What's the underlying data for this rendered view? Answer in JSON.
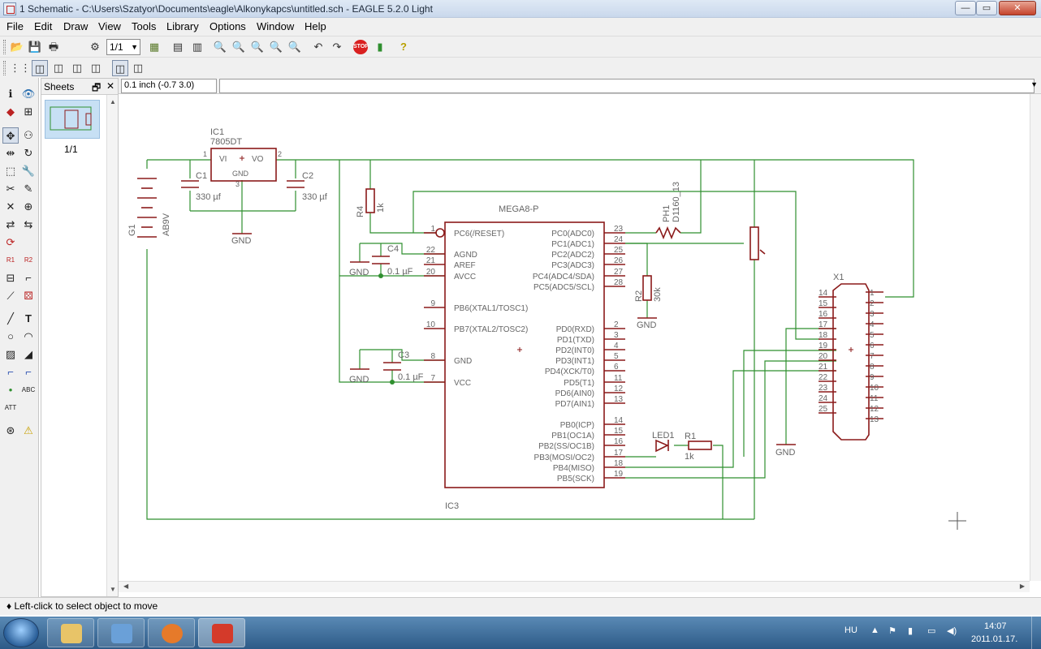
{
  "window": {
    "title": "1 Schematic - C:\\Users\\Szatyor\\Documents\\eagle\\Alkonykapcs\\untitled.sch - EAGLE 5.2.0 Light",
    "buttons": {
      "minimize": "—",
      "maximize": "▭",
      "close": "✕"
    }
  },
  "menu": [
    "File",
    "Edit",
    "Draw",
    "View",
    "Tools",
    "Library",
    "Options",
    "Window",
    "Help"
  ],
  "toolbar": {
    "sheet_select": "1/1",
    "stop_label": "STOP",
    "icons": [
      "open-icon",
      "save-icon",
      "print-icon",
      "cam-icon",
      "sheet-select",
      "board-icon",
      "script-icon",
      "ulp-icon",
      "zoom-fit-icon",
      "zoom-in-icon",
      "zoom-out-icon",
      "zoom-redraw-icon",
      "zoom-select-icon",
      "undo-icon",
      "redo-icon",
      "stop-icon",
      "go-icon",
      "help-icon"
    ]
  },
  "sheets_panel": {
    "title": "Sheets",
    "float_btn": "🗗",
    "close_btn": "✕",
    "sheet_label": "1/1"
  },
  "coord": {
    "value": "0.1 inch (-0.7 3.0)"
  },
  "status": {
    "message": "♦ Left-click to select object to move"
  },
  "left_tools": [
    "info-icon",
    "show-icon",
    "display-icon",
    "mark-icon",
    "move-icon",
    "copy-icon",
    "mirror-icon",
    "rotate-icon",
    "group-icon",
    "change-icon",
    "cut-icon",
    "paste-icon",
    "delete-icon",
    "add-icon",
    "pinswap-icon",
    "gateswap-icon",
    "replace-icon",
    "name-icon",
    "value-icon",
    "smash-icon",
    "miter-icon",
    "split-icon",
    "invoke-icon",
    "wire-icon",
    "text-icon",
    "circle-icon",
    "arc-icon",
    "rect-icon",
    "polygon-icon",
    "bus-icon",
    "net-icon",
    "junction-icon",
    "label-icon",
    "attribute-icon",
    "erc-icon",
    "errors-icon"
  ],
  "schematic": {
    "ic1_name": "IC1",
    "ic1_value": "7805DT",
    "ic1_vi": "VI",
    "ic1_vo": "VO",
    "ic1_gnd": "GND",
    "ic1_pin1": "1",
    "ic1_pin2": "2",
    "ic1_pin3": "3",
    "c1_name": "C1",
    "c1_value": "330 µf",
    "c2_name": "C2",
    "c2_value": "330 µf",
    "g1_name": "G1",
    "g1_value": "AB9V",
    "r4_name": "R4",
    "r4_value": "1k",
    "mega_value": "MEGA8-P",
    "ic3_name": "IC3",
    "c4_name": "C4",
    "c4_value": "0.1 µF",
    "c3_name": "C3",
    "c3_value": "0.1 µF",
    "ph1_name": "PH1",
    "ph1_value": "D1160_13",
    "r2_name": "R2",
    "r2_value": "30k",
    "led1_name": "LED1",
    "r1_name": "R1",
    "r1_value": "1k",
    "x1_name": "X1",
    "gnd": "GND",
    "pins_left": [
      {
        "num": "1",
        "name": "PC6(/RESET)"
      },
      {
        "num": "22",
        "name": "AGND"
      },
      {
        "num": "21",
        "name": "AREF"
      },
      {
        "num": "20",
        "name": "AVCC"
      },
      {
        "num": "9",
        "name": "PB6(XTAL1/TOSC1)"
      },
      {
        "num": "10",
        "name": "PB7(XTAL2/TOSC2)"
      },
      {
        "num": "8",
        "name": "GND"
      },
      {
        "num": "7",
        "name": "VCC"
      }
    ],
    "pins_right": [
      {
        "num": "23",
        "name": "PC0(ADC0)"
      },
      {
        "num": "24",
        "name": "PC1(ADC1)"
      },
      {
        "num": "25",
        "name": "PC2(ADC2)"
      },
      {
        "num": "26",
        "name": "PC3(ADC3)"
      },
      {
        "num": "27",
        "name": "PC4(ADC4/SDA)"
      },
      {
        "num": "28",
        "name": "PC5(ADC5/SCL)"
      },
      {
        "num": "2",
        "name": "PD0(RXD)"
      },
      {
        "num": "3",
        "name": "PD1(TXD)"
      },
      {
        "num": "4",
        "name": "PD2(INT0)"
      },
      {
        "num": "5",
        "name": "PD3(INT1)"
      },
      {
        "num": "6",
        "name": "PD4(XCK/T0)"
      },
      {
        "num": "11",
        "name": "PD5(T1)"
      },
      {
        "num": "12",
        "name": "PD6(AIN0)"
      },
      {
        "num": "13",
        "name": "PD7(AIN1)"
      },
      {
        "num": "14",
        "name": "PB0(ICP)"
      },
      {
        "num": "15",
        "name": "PB1(OC1A)"
      },
      {
        "num": "16",
        "name": "PB2(SS/OC1B)"
      },
      {
        "num": "17",
        "name": "PB3(MOSI/OC2)"
      },
      {
        "num": "18",
        "name": "PB4(MISO)"
      },
      {
        "num": "19",
        "name": "PB5(SCK)"
      }
    ],
    "x1_left": [
      "14",
      "15",
      "16",
      "17",
      "18",
      "19",
      "20",
      "21",
      "22",
      "23",
      "24",
      "25"
    ],
    "x1_right": [
      "1",
      "2",
      "3",
      "4",
      "5",
      "6",
      "7",
      "8",
      "9",
      "10",
      "11",
      "12",
      "13"
    ]
  },
  "taskbar": {
    "lang": "HU",
    "time": "14:07",
    "date": "2011.01.17.",
    "apps": [
      "explorer-icon",
      "users-icon",
      "firefox-icon",
      "eagle-icon"
    ]
  },
  "colors": {
    "symbol": "#8b1a1a",
    "net": "#2f8f2f",
    "text": "#666666"
  }
}
